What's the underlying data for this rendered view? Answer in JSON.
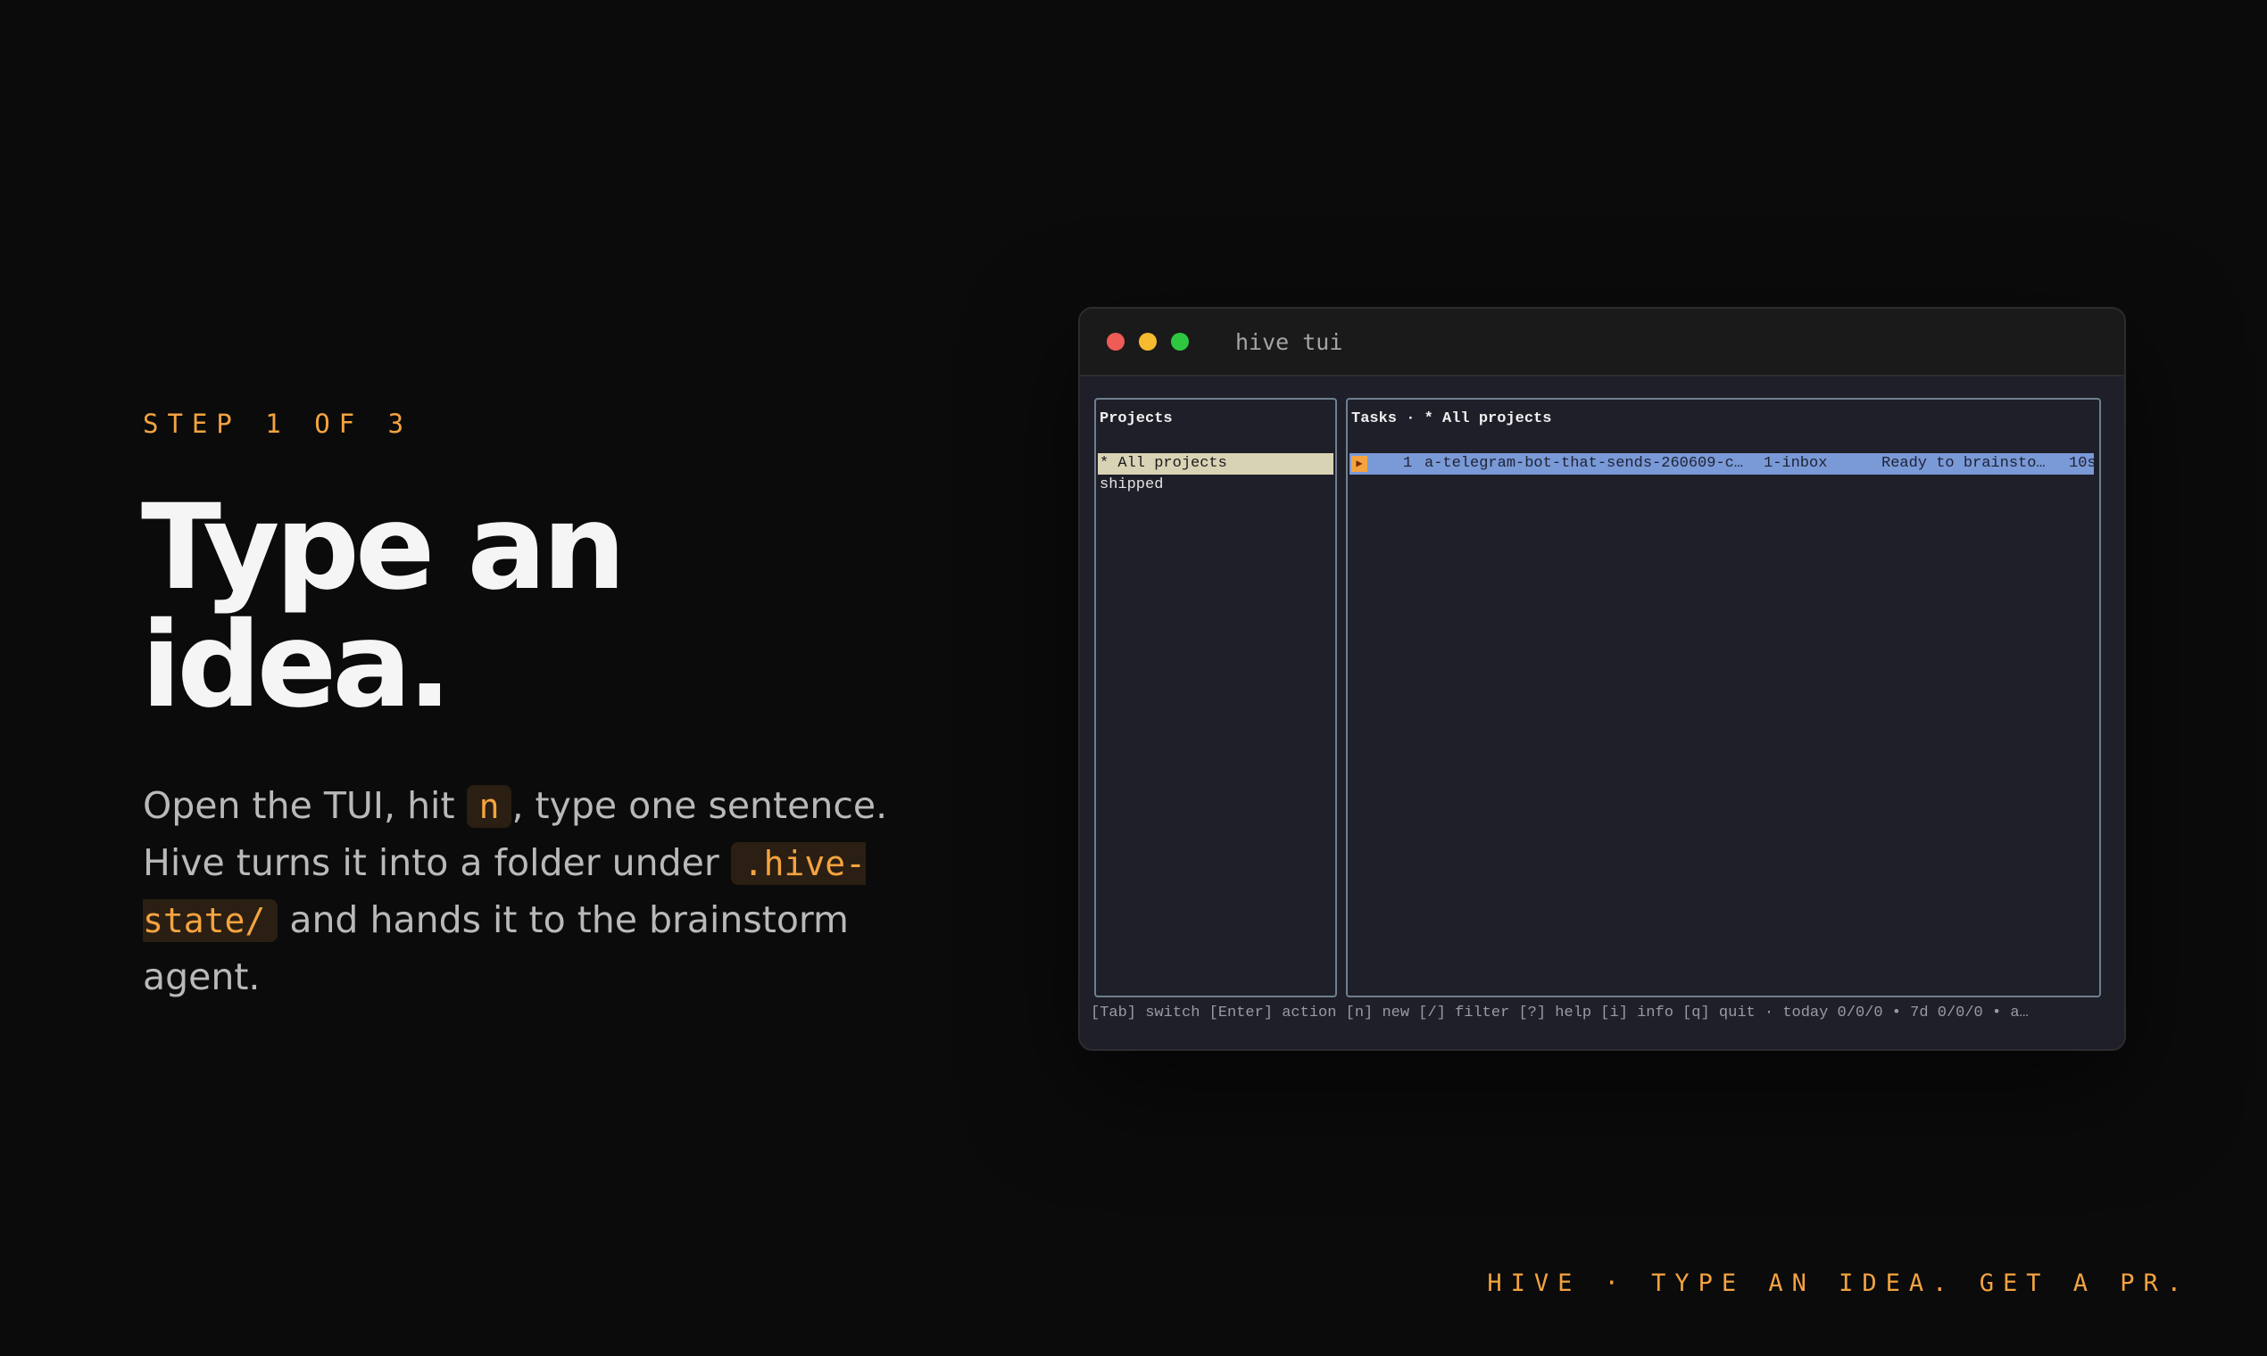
{
  "intro": {
    "step": "STEP 1 OF 3",
    "headline_line1": "Type an",
    "headline_line2": "idea.",
    "body_part1": "Open the TUI, hit ",
    "body_key": "n",
    "body_part2": ", type one sentence. Hive turns it into a folder under ",
    "body_path": ".hive-state/",
    "body_part3": " and hands it to the brainstorm agent."
  },
  "window": {
    "title": "hive tui"
  },
  "projects_pane": {
    "title": "Projects",
    "items": [
      {
        "label": "* All projects",
        "selected": true
      },
      {
        "label": "shipped",
        "selected": false
      }
    ]
  },
  "tasks_pane": {
    "title": "Tasks · * All projects",
    "rows": [
      {
        "icon": "play-icon",
        "index": "1",
        "name": "a-telegram-bot-that-sends-260609-c…",
        "stage": "1-inbox",
        "status": "Ready to brainsto…",
        "age": "10s"
      }
    ]
  },
  "status_bar": "[Tab] switch  [Enter] action  [n] new  [/] filter  [?] help  [i] info  [q] quit · today 0/0/0 • 7d 0/0/0 • a…",
  "footer": "HIVE · TYPE AN IDEA. GET A PR.",
  "colors": {
    "accent": "#f4a340",
    "background": "#0b0b0b",
    "selection": "#7a99d7",
    "project_selection": "#d9d3b6"
  }
}
